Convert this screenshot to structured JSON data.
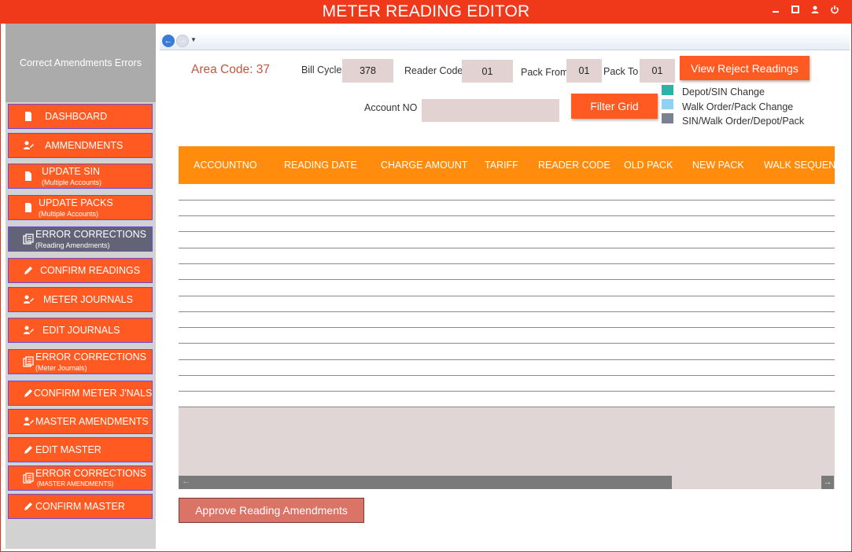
{
  "window": {
    "title": "METER READING EDITOR",
    "controls": [
      "minimize-icon",
      "maximize-icon",
      "user-icon",
      "power-icon"
    ],
    "accent": "#f0381a"
  },
  "sidebar": {
    "header": "Correct Amendments Errors",
    "items": [
      {
        "label": "DASHBOARD",
        "sub": "",
        "icon": "document-icon",
        "active": false
      },
      {
        "label": "AMMENDMENTS",
        "sub": "",
        "icon": "user-edit-icon",
        "active": false
      },
      {
        "label": "UPDATE SIN",
        "sub": "(Multiple Accounts)",
        "icon": "file-icon",
        "active": false
      },
      {
        "label": "UPDATE PACKS",
        "sub": "(Multiple Accounts)",
        "icon": "document-icon",
        "active": false
      },
      {
        "label": "ERROR CORRECTIONS",
        "sub": "(Reading Amendments)",
        "icon": "list-icon",
        "active": true
      },
      {
        "label": "CONFIRM READINGS",
        "sub": "",
        "icon": "pencil-icon",
        "active": false
      },
      {
        "label": "METER JOURNALS",
        "sub": "",
        "icon": "user-edit-icon",
        "active": false
      },
      {
        "label": "EDIT JOURNALS",
        "sub": "",
        "icon": "user-edit-icon",
        "active": false
      },
      {
        "label": "ERROR CORRECTIONS",
        "sub": "(Meter Journals)",
        "icon": "list-icon",
        "active": false
      },
      {
        "label": "CONFIRM METER J'NALS",
        "sub": "",
        "icon": "pencil-icon",
        "active": false
      },
      {
        "label": "MASTER AMENDMENTS",
        "sub": "",
        "icon": "user-edit-icon",
        "active": false
      },
      {
        "label": "EDIT MASTER",
        "sub": "",
        "icon": "pencil-icon",
        "active": false
      },
      {
        "label": "ERROR CORRECTIONS",
        "sub": "(MASTER AMENDMENTS)",
        "icon": "list-icon",
        "active": false
      },
      {
        "label": "CONFIRM MASTER",
        "sub": "",
        "icon": "pencil-icon",
        "active": false
      }
    ]
  },
  "form": {
    "area_code": "Area Code: 37",
    "bill_cycle_label": "Bill Cycle",
    "bill_cycle_value": "378",
    "reader_code_label": "Reader Code",
    "reader_code_value": "01",
    "pack_from_label": "Pack From",
    "pack_from_value": "01",
    "pack_to_label": "Pack To",
    "pack_to_value": "01",
    "account_no_label": "Account NO",
    "account_no_value": "",
    "view_reject_label": "View Reject Readings",
    "filter_grid_label": "Filter Grid"
  },
  "legend": [
    {
      "label": "Depot/SIN Change",
      "color": "#2ab3a6"
    },
    {
      "label": "Walk Order/Pack Change",
      "color": "#8fd3f4"
    },
    {
      "label": "SIN/Walk Order/Depot/Pack",
      "color": "#7a8190"
    }
  ],
  "grid": {
    "columns": [
      "ACCOUNTNO",
      "READING DATE",
      "CHARGE AMOUNT",
      "TARIFF",
      "READER CODE",
      "OLD PACK",
      "NEW PACK",
      "WALK SEQUENCE"
    ],
    "header_color": "#ff8c0c",
    "rows": []
  },
  "footer": {
    "approve_label": "Approve Reading Amendments"
  }
}
